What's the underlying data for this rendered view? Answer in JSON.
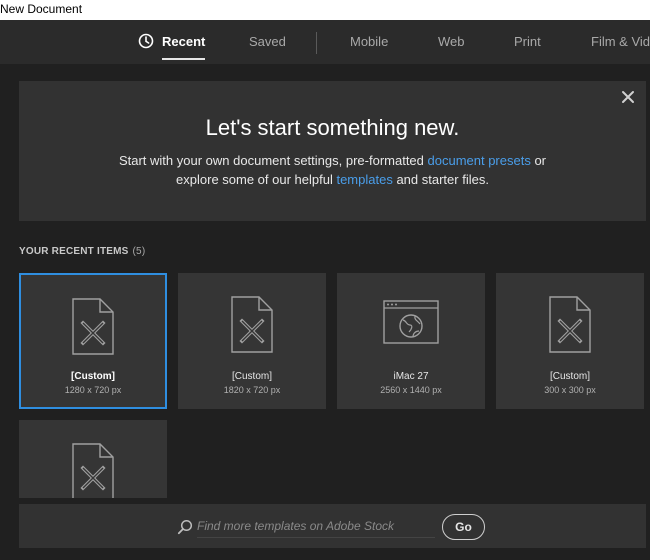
{
  "window": {
    "title": "New Document"
  },
  "tabs": [
    {
      "label": "Recent",
      "active": true,
      "icon": "clock-icon"
    },
    {
      "label": "Saved"
    },
    {
      "label": "Mobile"
    },
    {
      "label": "Web"
    },
    {
      "label": "Print"
    },
    {
      "label": "Film & Video"
    }
  ],
  "hero": {
    "title": "Let's start something new.",
    "line1_pre": "Start with your own document settings, pre-formatted ",
    "line1_link": "document presets",
    "line1_post": " or",
    "line2_pre": "explore some of our helpful ",
    "line2_link": "templates",
    "line2_post": " and starter files.",
    "link_color": "#4a9eea"
  },
  "recent": {
    "label": "YOUR RECENT ITEMS",
    "count": "(5)",
    "items": [
      {
        "name": "[Custom]",
        "size": "1280 x 720 px",
        "icon": "document-icon",
        "selected": true
      },
      {
        "name": "[Custom]",
        "size": "1820 x 720 px",
        "icon": "document-icon"
      },
      {
        "name": "iMac 27",
        "size": "2560 x 1440 px",
        "icon": "web-browser-icon"
      },
      {
        "name": "[Custom]",
        "size": "300 x 300 px",
        "icon": "document-icon"
      },
      {
        "name": "",
        "size": "",
        "icon": "document-icon"
      }
    ]
  },
  "stock": {
    "placeholder": "Find more templates on Adobe Stock",
    "go_label": "Go"
  },
  "colors": {
    "accent": "#2f8ee0",
    "background": "#202020",
    "panel": "#323232",
    "card": "#353535"
  }
}
